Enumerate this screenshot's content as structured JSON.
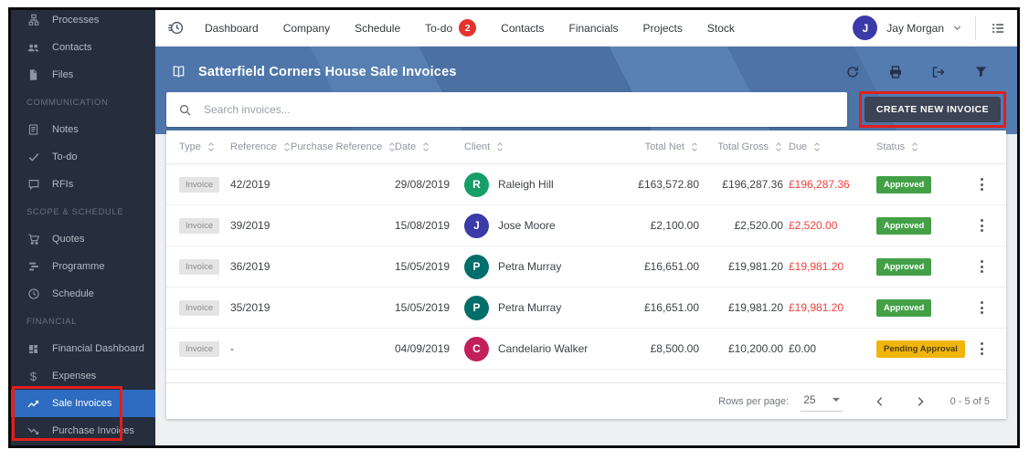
{
  "topbar": {
    "nav": [
      {
        "label": "Dashboard"
      },
      {
        "label": "Company"
      },
      {
        "label": "Schedule"
      },
      {
        "label": "To-do",
        "badge": "2"
      },
      {
        "label": "Contacts"
      },
      {
        "label": "Financials"
      },
      {
        "label": "Projects"
      },
      {
        "label": "Stock"
      }
    ],
    "user": {
      "initial": "J",
      "name": "Jay Morgan"
    }
  },
  "sidebar": {
    "sections": [
      {
        "items": [
          {
            "label": "Processes"
          },
          {
            "label": "Contacts"
          },
          {
            "label": "Files"
          }
        ]
      },
      {
        "header": "COMMUNICATION",
        "items": [
          {
            "label": "Notes"
          },
          {
            "label": "To-do"
          },
          {
            "label": "RFIs"
          }
        ]
      },
      {
        "header": "SCOPE & SCHEDULE",
        "items": [
          {
            "label": "Quotes"
          },
          {
            "label": "Programme"
          },
          {
            "label": "Schedule"
          }
        ]
      },
      {
        "header": "FINANCIAL",
        "items": [
          {
            "label": "Financial Dashboard"
          },
          {
            "label": "Expenses"
          },
          {
            "label": "Sale Invoices"
          },
          {
            "label": "Purchase Invoices"
          }
        ]
      }
    ]
  },
  "page": {
    "title": "Satterfield Corners House Sale Invoices"
  },
  "search": {
    "placeholder": "Search invoices..."
  },
  "actions": {
    "create_invoice": "CREATE NEW INVOICE"
  },
  "table": {
    "columns": [
      "Type",
      "Reference",
      "Purchase Reference",
      "Date",
      "Client",
      "Total Net",
      "Total Gross",
      "Due",
      "Status"
    ],
    "rows": [
      {
        "type": "Invoice",
        "reference": "42/2019",
        "purchase_reference": "",
        "date": "29/08/2019",
        "client": "Raleigh Hill",
        "initial": "R",
        "avatar_color": "#179e68",
        "total_net": "£163,572.80",
        "total_gross": "£196,287.36",
        "due": "£196,287.36",
        "due_color": "#f0413c",
        "status": "Approved",
        "status_bg": "#43a047",
        "status_color": "#ffffff"
      },
      {
        "type": "Invoice",
        "reference": "39/2019",
        "purchase_reference": "",
        "date": "15/08/2019",
        "client": "Jose Moore",
        "initial": "J",
        "avatar_color": "#3a3aa8",
        "total_net": "£2,100.00",
        "total_gross": "£2,520.00",
        "due": "£2,520.00",
        "due_color": "#f0413c",
        "status": "Approved",
        "status_bg": "#43a047",
        "status_color": "#ffffff"
      },
      {
        "type": "Invoice",
        "reference": "36/2019",
        "purchase_reference": "",
        "date": "15/05/2019",
        "client": "Petra Murray",
        "initial": "P",
        "avatar_color": "#006f6c",
        "total_net": "£16,651.00",
        "total_gross": "£19,981.20",
        "due": "£19,981.20",
        "due_color": "#f0413c",
        "status": "Approved",
        "status_bg": "#43a047",
        "status_color": "#ffffff"
      },
      {
        "type": "Invoice",
        "reference": "35/2019",
        "purchase_reference": "",
        "date": "15/05/2019",
        "client": "Petra Murray",
        "initial": "P",
        "avatar_color": "#006f6c",
        "total_net": "£16,651.00",
        "total_gross": "£19,981.20",
        "due": "£19,981.20",
        "due_color": "#f0413c",
        "status": "Approved",
        "status_bg": "#43a047",
        "status_color": "#ffffff"
      },
      {
        "type": "Invoice",
        "reference": "-",
        "purchase_reference": "",
        "date": "04/09/2019",
        "client": "Candelario Walker",
        "initial": "C",
        "avatar_color": "#c21f5b",
        "total_net": "£8,500.00",
        "total_gross": "£10,200.00",
        "due": "£0.00",
        "due_color": "#3e4247",
        "status": "Pending Approval",
        "status_bg": "#f2b50e",
        "status_color": "#4e3f08"
      }
    ]
  },
  "pagination": {
    "rows_per_page_label": "Rows per page:",
    "rows_per_page": "25",
    "range": "0 - 5 of 5"
  },
  "colors": {
    "sidebar_bg": "#262e3d",
    "active_blue": "#2d6cc1",
    "banner_blue": "#4d73a7",
    "badge_red": "#e5322d",
    "annotation_red": "#e11f1b",
    "approved_green": "#43a047",
    "pending_yellow": "#f2b50e",
    "due_red": "#f0413c"
  }
}
